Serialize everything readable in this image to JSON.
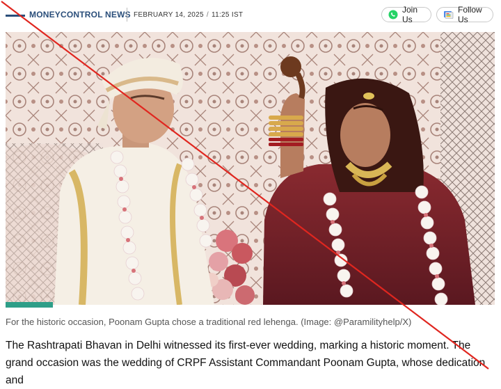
{
  "header": {
    "brand": "MONEYCONTROL NEWS",
    "date": "FEBRUARY 14, 2025",
    "time": "11:25 IST",
    "join_label": "Join Us",
    "follow_label": "Follow Us",
    "join_icon": "whatsapp-icon",
    "follow_icon": "google-news-icon"
  },
  "article": {
    "caption": "For the historic occasion, Poonam Gupta chose a traditional red lehenga. (Image: @Paramilityhelp/X)",
    "body": "The Rashtrapati Bhavan in Delhi witnessed its first-ever wedding, marking a historic moment. The grand occasion was the wedding of CRPF Assistant Commandant Poonam Gupta, whose dedication and"
  },
  "colors": {
    "brand": "#2a4e7a",
    "accent": "#2e9e88",
    "strike": "#e0261f"
  }
}
